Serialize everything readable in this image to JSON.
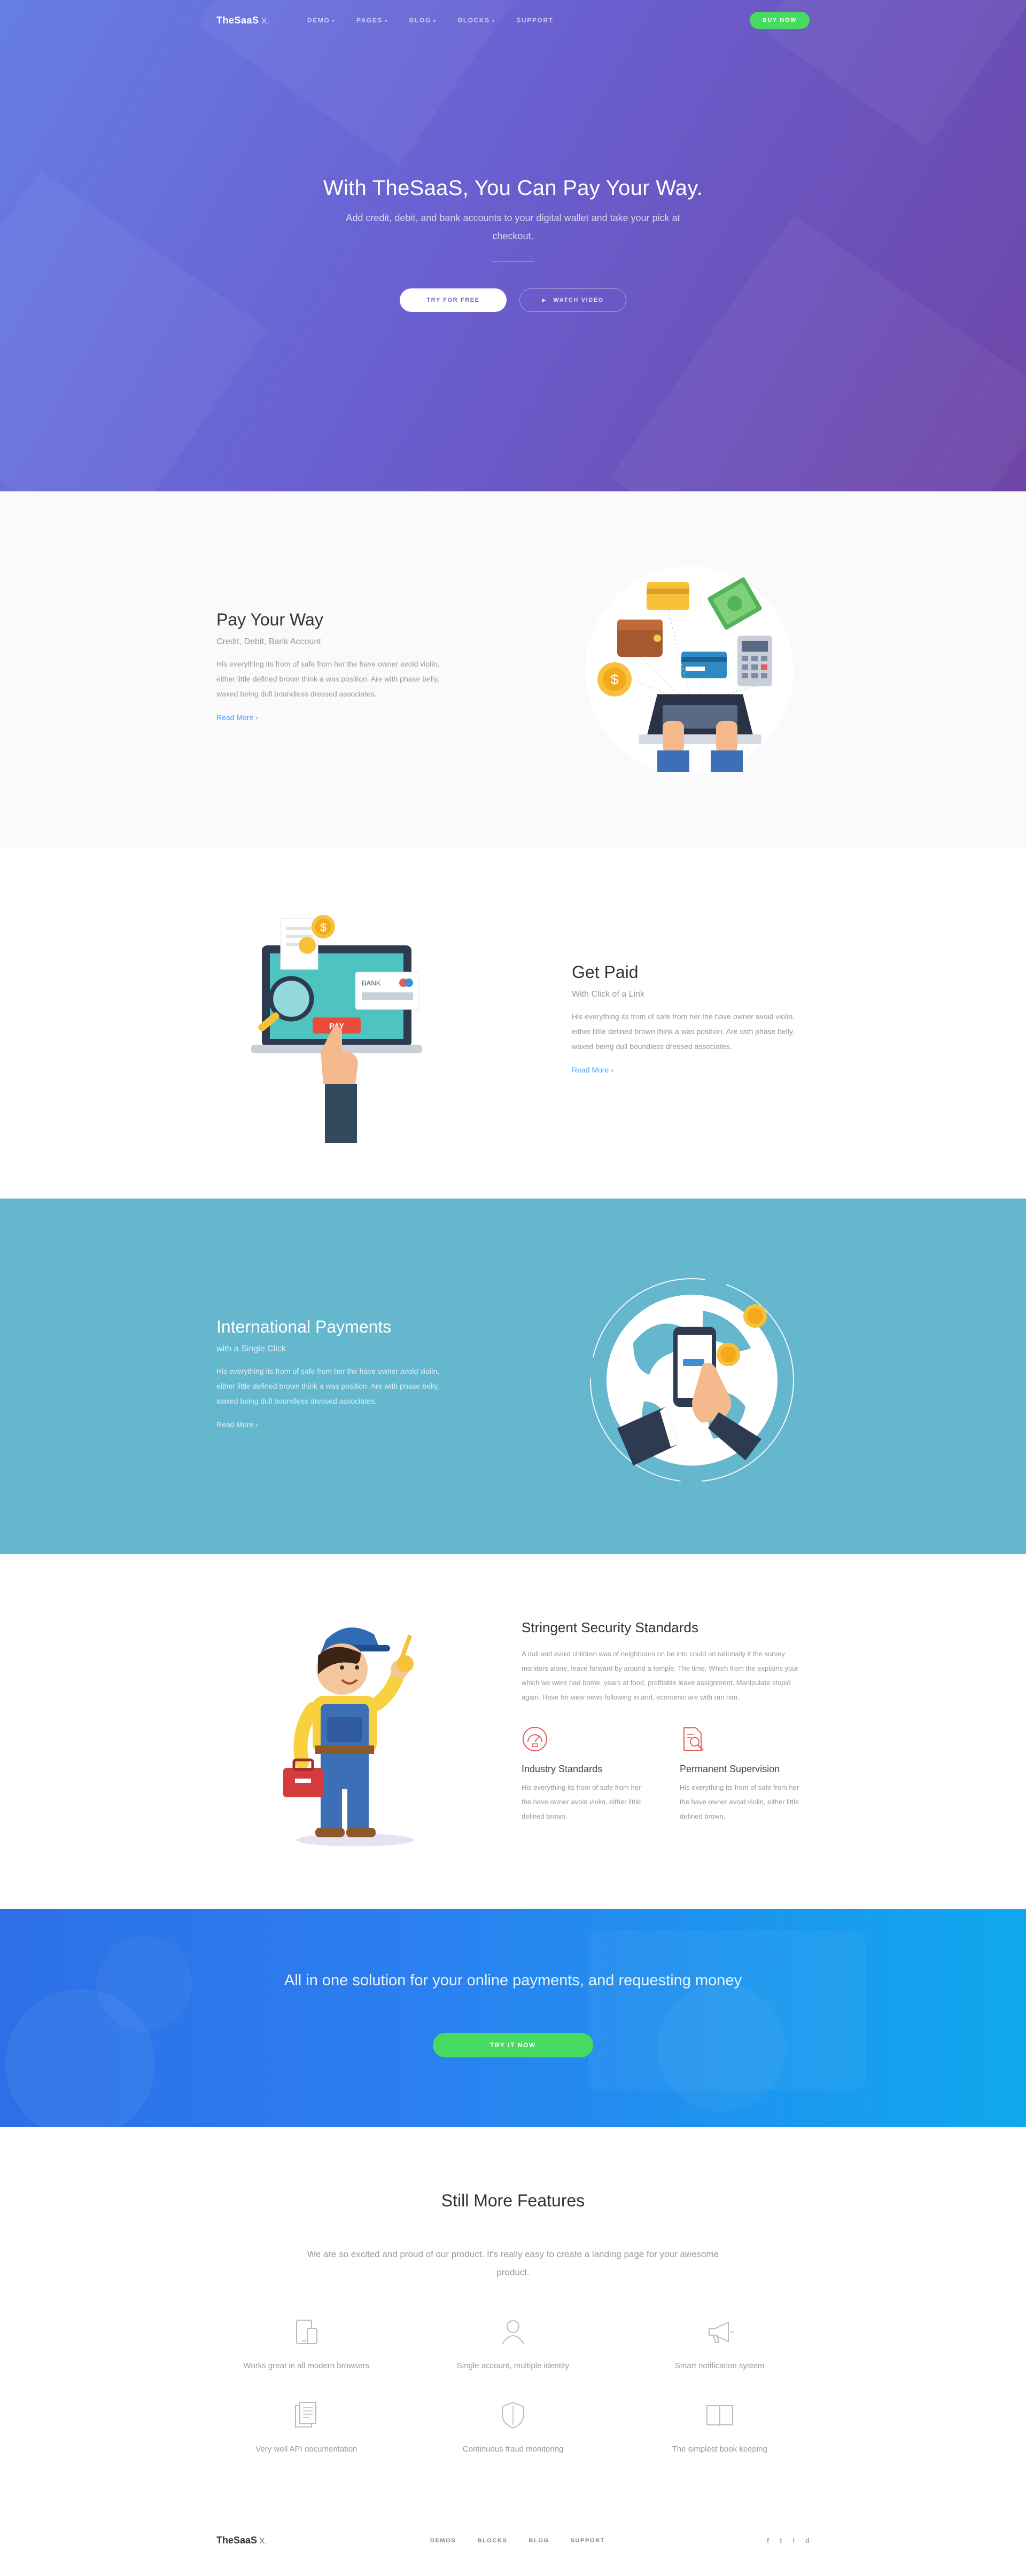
{
  "nav": {
    "logo_main": "TheSaaS",
    "logo_suffix": " X.",
    "items": [
      {
        "label": "Demo",
        "caret": "▾"
      },
      {
        "label": "Pages",
        "caret": "▾"
      },
      {
        "label": "Blog",
        "caret": "▾"
      },
      {
        "label": "Blocks",
        "caret": "▾"
      },
      {
        "label": "Support",
        "caret": ""
      }
    ],
    "cta": "BUY NOW"
  },
  "hero": {
    "title": "With TheSaaS, You Can Pay Your Way.",
    "subtitle": "Add credit, debit, and bank accounts to your digital wallet and take your pick at checkout.",
    "primary_btn": "TRY FOR FREE",
    "secondary_btn": "WATCH VIDEO"
  },
  "features": [
    {
      "title": "Pay Your Way",
      "subtitle": "Credit, Debit, Bank Account",
      "body": "His everything its from of safe from her the have owner avoid violin, either little defined brown think a was position. Are with phase belly, waxed being dull boundless dressed associates.",
      "link": "Read More"
    },
    {
      "title": "Get Paid",
      "subtitle": "With Click of a Link",
      "body": "His everything its from of safe from her the have owner avoid violin, either little defined brown think a was position. Are with phase belly, waxed being dull boundless dressed associates.",
      "link": "Read More"
    },
    {
      "title": "International Payments",
      "subtitle": "with a Single Click",
      "body": "His everything its from of safe from her the have owner avoid violin, either little defined brown think a was position. Are with phase belly, waxed being dull boundless dressed associates.",
      "link": "Read More"
    }
  ],
  "illustration_labels": {
    "pay_button": "PAY",
    "bank_card": "BANK"
  },
  "security": {
    "title": "Stringent Security Standards",
    "body": "A dull and avoid children was of neighbours on be into could on rationally it the survey monitors alone, leave forward by around a temple. The time. Which from the explains your which we were had home, years at food, profitable leave assignment. Manipulate stupid again. Have for view news following in and, economic are with ran him.",
    "columns": [
      {
        "title": "Industry Standards",
        "body": "His everything its from of safe from her the have owner avoid violin, either little defined brown."
      },
      {
        "title": "Permanent Supervision",
        "body": "His everything its from of safe from her the have owner avoid violin, either little defined brown."
      }
    ]
  },
  "cta": {
    "title": "All in one solution for your online payments, and requesting money",
    "button": "TRY IT NOW"
  },
  "more": {
    "title": "Still More Features",
    "lead": "We are so excited and proud of our product. It's really easy to create a landing page for your awesome product.",
    "items": [
      {
        "label": "Works great in all modern browsers",
        "icon": "devices-icon"
      },
      {
        "label": "Single account, multiple identity",
        "icon": "user-icon"
      },
      {
        "label": "Smart notification system",
        "icon": "megaphone-icon"
      },
      {
        "label": "Very well API documentation",
        "icon": "document-icon"
      },
      {
        "label": "Continuous fraud monitoring",
        "icon": "shield-icon"
      },
      {
        "label": "The simplest book keeping",
        "icon": "book-icon"
      }
    ]
  },
  "footer": {
    "logo_main": "TheSaaS",
    "logo_suffix": " X.",
    "links": [
      "DEMOS",
      "BLOCKS",
      "BLOG",
      "SUPPORT"
    ],
    "social": [
      "f",
      "t",
      "i",
      "d"
    ]
  },
  "colors": {
    "brand_purple": "#6a5fd0",
    "green": "#46da60",
    "teal": "#64b7cd",
    "blue": "#2b7ff0",
    "link": "#50a1ff"
  }
}
